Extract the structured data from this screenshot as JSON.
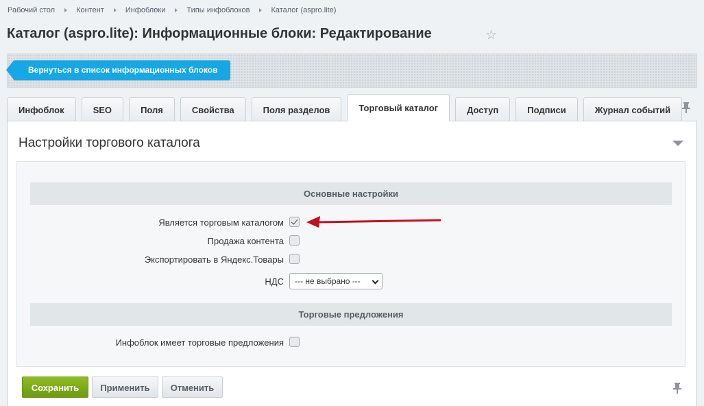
{
  "breadcrumb": {
    "items": [
      "Рабочий стол",
      "Контент",
      "Инфоблоки",
      "Типы инфоблоков",
      "Каталог (aspro.lite)"
    ]
  },
  "page": {
    "title": "Каталог (aspro.lite): Информационные блоки: Редактирование"
  },
  "toolbar": {
    "back_label": "Вернуться в список информационных блоков"
  },
  "tabs": [
    {
      "label": "Инфоблок"
    },
    {
      "label": "SEO"
    },
    {
      "label": "Поля"
    },
    {
      "label": "Свойства"
    },
    {
      "label": "Поля разделов"
    },
    {
      "label": "Торговый каталог",
      "active": true
    },
    {
      "label": "Доступ"
    },
    {
      "label": "Подписи"
    },
    {
      "label": "Журнал событий"
    }
  ],
  "panel": {
    "title": "Настройки торгового каталога",
    "sections": {
      "main": {
        "title": "Основные настройки",
        "is_catalog": {
          "label": "Является торговым каталогом",
          "checked": true
        },
        "content_sale": {
          "label": "Продажа контента",
          "checked": false
        },
        "yandex_export": {
          "label": "Экспортировать в Яндекс.Товары",
          "checked": false
        },
        "vat": {
          "label": "НДС",
          "selected": "--- не выбрано ---"
        }
      },
      "offers": {
        "title": "Торговые предложения",
        "has_offers": {
          "label": "Инфоблок имеет торговые предложения",
          "checked": false
        }
      }
    }
  },
  "footer": {
    "save_label": "Сохранить",
    "apply_label": "Применить",
    "cancel_label": "Отменить"
  },
  "colors": {
    "accent_blue": "#16a7e6",
    "save_green": "#7aa817",
    "annotation_red": "#c0111f"
  }
}
